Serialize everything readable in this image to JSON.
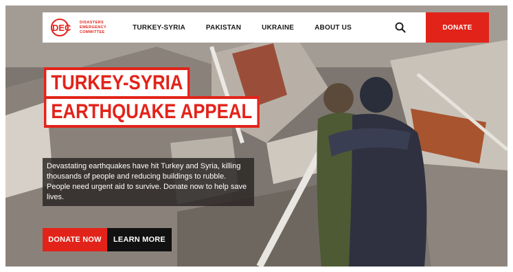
{
  "brand": {
    "logo_lines": [
      "DISASTERS",
      "EMERGENCY",
      "COMMITTEE"
    ],
    "accent_color": "#e2231a"
  },
  "nav": {
    "links": [
      "TURKEY-SYRIA",
      "PAKISTAN",
      "UKRAINE",
      "ABOUT US"
    ],
    "search_icon": "search-icon",
    "donate_label": "DONATE"
  },
  "hero": {
    "headline_line1": "TURKEY-SYRIA",
    "headline_line2": "EARTHQUAKE APPEAL",
    "description": "Devastating earthquakes have hit Turkey and Syria, killing thousands of people and reducing buildings to rubble. People need urgent aid to survive. Donate now to help save lives.",
    "primary_cta": "DONATE NOW",
    "secondary_cta": "LEARN MORE"
  }
}
